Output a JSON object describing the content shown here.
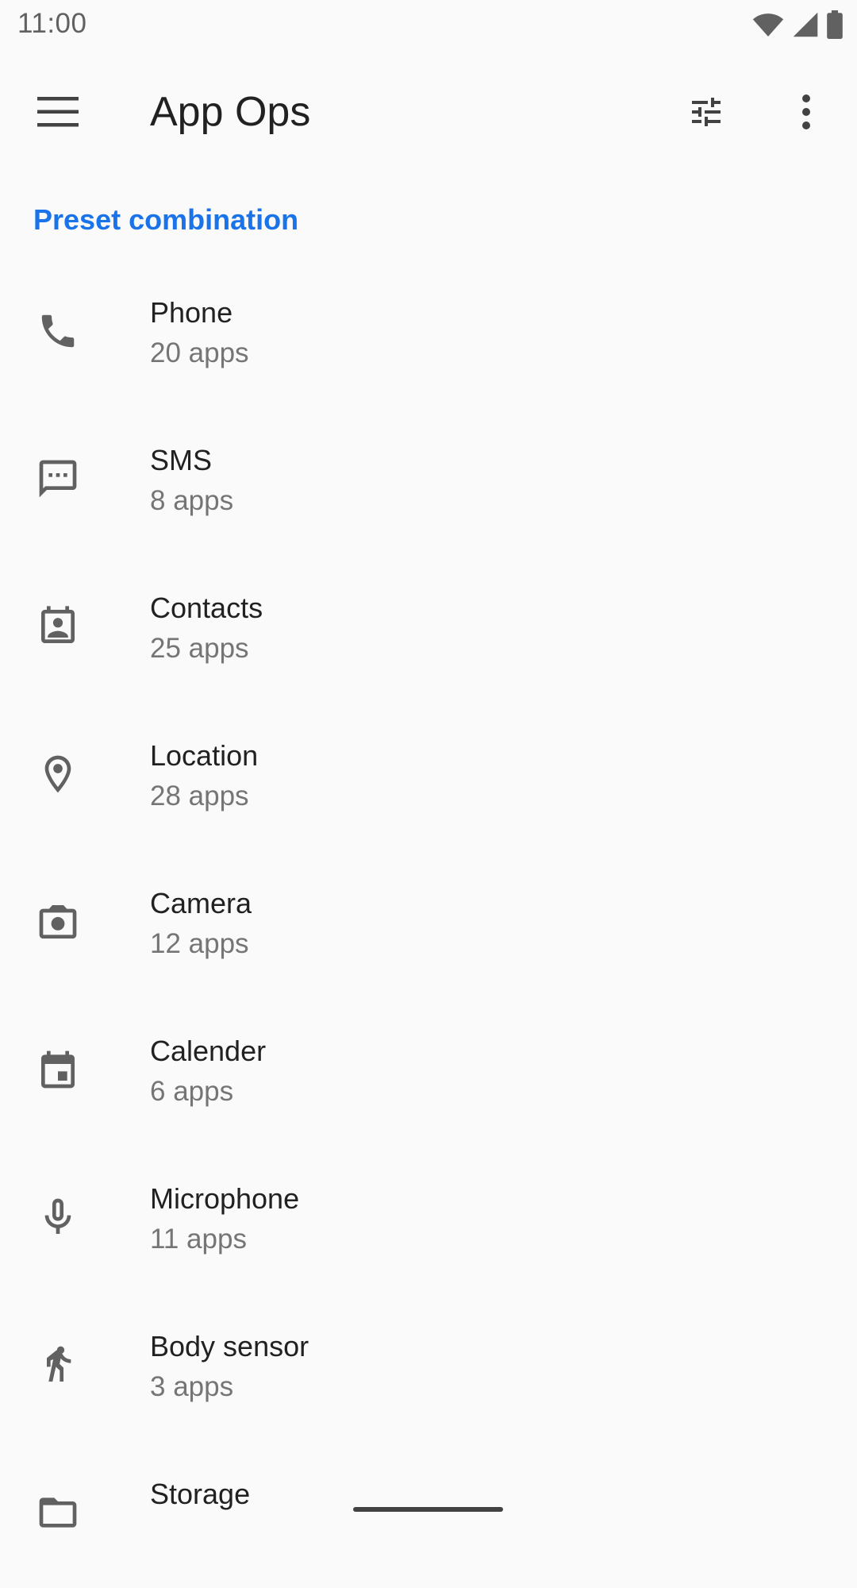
{
  "status_bar": {
    "time": "11:00",
    "icons": [
      "wifi-icon",
      "signal-icon",
      "battery-icon"
    ]
  },
  "app_bar": {
    "title": "App Ops",
    "icons": [
      "menu-icon",
      "tune-icon",
      "more-vert-icon"
    ]
  },
  "section": {
    "header": "Preset combination"
  },
  "colors": {
    "accent": "#1a73e8",
    "icon": "#616161",
    "background": "#fafafa"
  },
  "permissions": [
    {
      "title": "Phone",
      "subtitle": "20 apps",
      "icon": "phone-icon"
    },
    {
      "title": "SMS",
      "subtitle": "8 apps",
      "icon": "sms-icon"
    },
    {
      "title": "Contacts",
      "subtitle": "25 apps",
      "icon": "contacts-icon"
    },
    {
      "title": "Location",
      "subtitle": "28 apps",
      "icon": "location-icon"
    },
    {
      "title": "Camera",
      "subtitle": "12 apps",
      "icon": "camera-icon"
    },
    {
      "title": "Calender",
      "subtitle": "6 apps",
      "icon": "calendar-icon"
    },
    {
      "title": "Microphone",
      "subtitle": "11 apps",
      "icon": "microphone-icon"
    },
    {
      "title": "Body sensor",
      "subtitle": "3 apps",
      "icon": "body-sensor-icon"
    },
    {
      "title": "Storage",
      "subtitle": "",
      "icon": "folder-icon"
    }
  ]
}
